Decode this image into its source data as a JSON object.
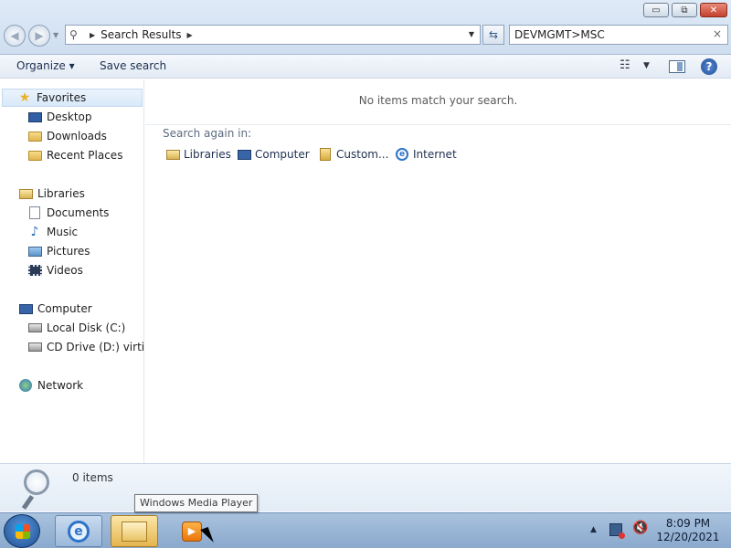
{
  "window": {
    "controls": {
      "minimize": "▭",
      "maximize": "⧉",
      "close": "✕"
    }
  },
  "nav": {
    "back_icon": "back-arrow-icon",
    "forward_icon": "forward-arrow-icon"
  },
  "address_bar": {
    "crumbs": [
      "Search Results"
    ]
  },
  "search": {
    "value": "DEVMGMT>MSC",
    "clear": "×"
  },
  "toolbar": {
    "organize_label": "Organize ▾",
    "save_search_label": "Save search",
    "help": "?"
  },
  "sidebar": {
    "favorites": {
      "label": "Favorites",
      "items": [
        "Desktop",
        "Downloads",
        "Recent Places"
      ]
    },
    "libraries": {
      "label": "Libraries",
      "items": [
        "Documents",
        "Music",
        "Pictures",
        "Videos"
      ]
    },
    "computer": {
      "label": "Computer",
      "items": [
        "Local Disk (C:)",
        "CD Drive (D:) virtio-win"
      ]
    },
    "network": {
      "label": "Network"
    }
  },
  "main": {
    "empty_message": "No items match your search.",
    "search_again_label": "Search again in:",
    "search_again_items": [
      "Libraries",
      "Computer",
      "Custom...",
      "Internet"
    ]
  },
  "details": {
    "item_count": "0 items"
  },
  "tooltip": {
    "text": "Windows Media Player"
  },
  "taskbar": {
    "time": "8:09 PM",
    "date": "12/20/2021"
  },
  "colors": {
    "chrome": "#cfdeef",
    "taskbar": "#9bb8da",
    "accent": "#2d73c7"
  }
}
